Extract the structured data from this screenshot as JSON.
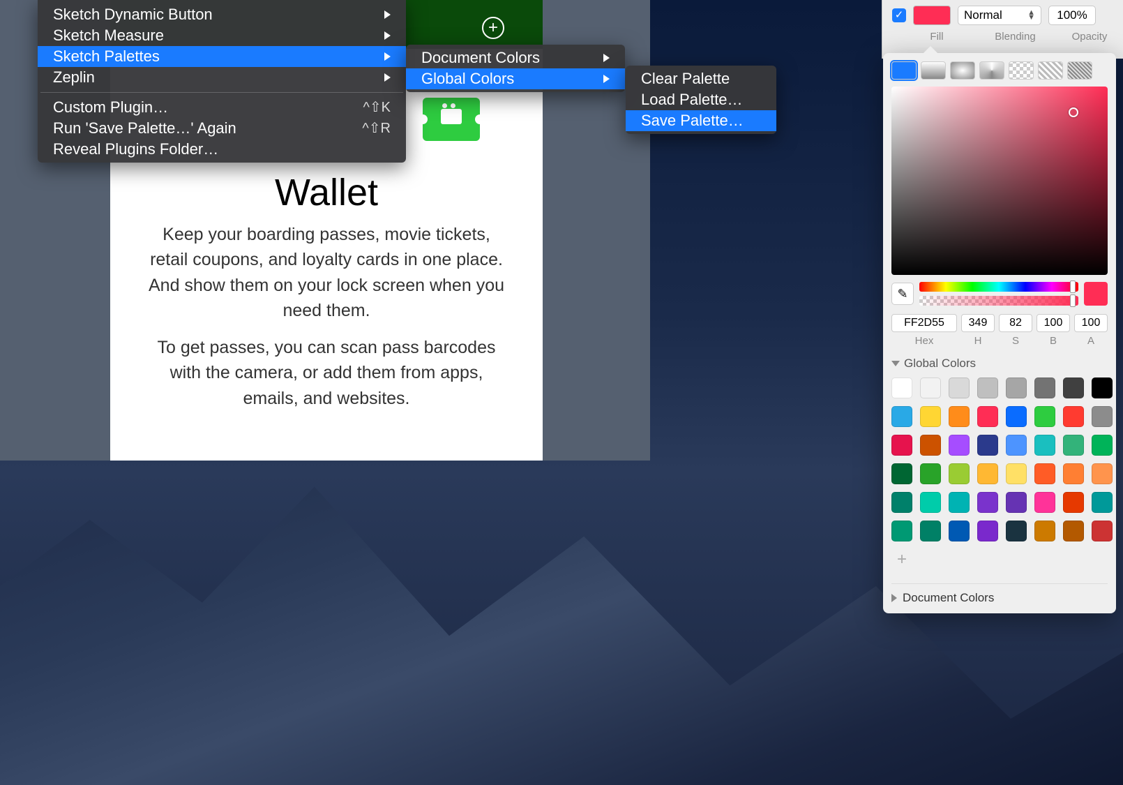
{
  "canvas": {
    "title": "Wallet",
    "paragraph1": "Keep your boarding passes, movie tickets, retail coupons, and loyalty cards in one place. And show them on your lock screen when you need them.",
    "paragraph2": "To get passes, you can scan pass barcodes with the camera, or add them from apps, emails, and websites."
  },
  "menu_main": {
    "items": [
      {
        "label": "Sketch Dynamic Button",
        "has_sub": true
      },
      {
        "label": "Sketch Measure",
        "has_sub": true
      },
      {
        "label": "Sketch Palettes",
        "has_sub": true,
        "highlight": true
      },
      {
        "label": "Zeplin",
        "has_sub": true
      }
    ],
    "custom_plugin": "Custom Plugin…",
    "custom_plugin_shortcut": "^⇧K",
    "run_again": "Run 'Save Palette…' Again",
    "run_again_shortcut": "^⇧R",
    "reveal_folder": "Reveal Plugins Folder…"
  },
  "menu_sub1": {
    "items": [
      {
        "label": "Document Colors",
        "has_sub": true
      },
      {
        "label": "Global Colors",
        "has_sub": true,
        "highlight": true
      }
    ]
  },
  "menu_sub2": {
    "items": [
      {
        "label": "Clear Palette"
      },
      {
        "label": "Load Palette…"
      },
      {
        "label": "Save Palette…",
        "highlight": true
      }
    ]
  },
  "inspector": {
    "fill_label": "Fill",
    "blending_label": "Blending",
    "opacity_label": "Opacity",
    "blending_value": "Normal",
    "opacity_value": "100%",
    "fill_color": "#FF2D55"
  },
  "picker": {
    "hex": "FF2D55",
    "h": "349",
    "s": "82",
    "b": "100",
    "a": "100",
    "hex_label": "Hex",
    "h_label": "H",
    "s_label": "S",
    "b_label": "B",
    "a_label": "A",
    "global_colors_label": "Global Colors",
    "document_colors_label": "Document Colors",
    "swatches": [
      "#ffffff",
      "#f2f2f2",
      "#d9d9d9",
      "#bfbfbf",
      "#a6a6a6",
      "#737373",
      "#404040",
      "#000000",
      "#29a9e6",
      "#ffd633",
      "#ff8c1a",
      "#ff2d55",
      "#0a6cff",
      "#2ecc40",
      "#ff3b30",
      "#8c8c8c",
      "#e6134d",
      "#cc5200",
      "#a64dff",
      "#2b3a8c",
      "#4d94ff",
      "#1abfbf",
      "#33b37a",
      "#00b359",
      "#006633",
      "#29a329",
      "#9acc33",
      "#ffb833",
      "#ffe066",
      "#ff5c26",
      "#ff7f33",
      "#ff944d",
      "#00806a",
      "#00ccaa",
      "#00b3b3",
      "#7a33cc",
      "#6633b3",
      "#ff3399",
      "#e63900",
      "#009999",
      "#009973",
      "#008066",
      "#0059b3",
      "#7a29cc",
      "#1a3340",
      "#cc7a00",
      "#b35900",
      "#cc3333"
    ]
  }
}
